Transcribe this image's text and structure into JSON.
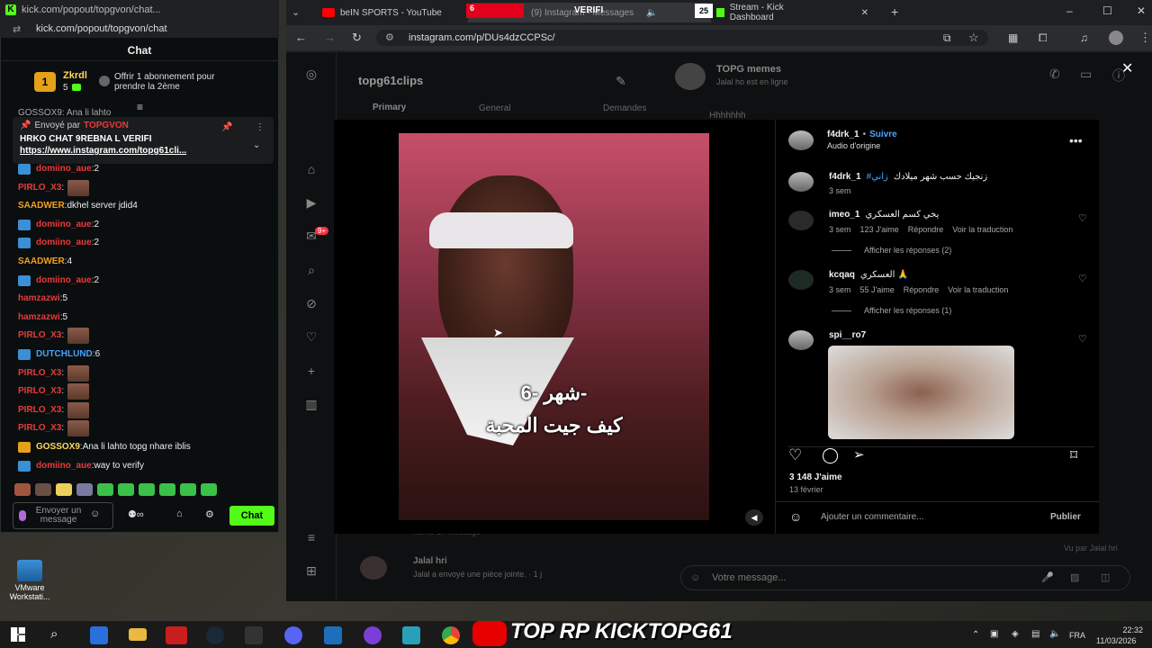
{
  "kick": {
    "tab_title": "kick.com/popout/topgvon/chat...",
    "url": "kick.com/popout/topgvon/chat",
    "header": "Chat",
    "sub_user": "Zkrdl",
    "sub_count": "5",
    "sub_badge": "1",
    "sub_offer": "Offrir 1 abonnement pour prendre la 2ème",
    "partial_line": "GOSSOX9: Ana li lahto",
    "pinned": {
      "sent_by_label": "Envoyé par",
      "sent_by_user": "TOPGVON",
      "title": "HRKO CHAT 9REBNA L VERIFI",
      "link": "https://www.instagram.com/topg61cli..."
    },
    "messages": [
      {
        "user": "domiino_aue",
        "sep": ": ",
        "text": "2",
        "color": "red",
        "icon": true
      },
      {
        "user": "PIRLO_X3",
        "sep": ": ",
        "text": "",
        "color": "red",
        "icon": false,
        "thumb": true
      },
      {
        "user": "SAADWER",
        "sep": ": ",
        "text": "dkhel server jdid4",
        "color": "orange",
        "icon": false
      },
      {
        "user": "domiino_aue",
        "sep": ": ",
        "text": "2",
        "color": "red",
        "icon": true
      },
      {
        "user": "domiino_aue",
        "sep": ": ",
        "text": "2",
        "color": "red",
        "icon": true
      },
      {
        "user": "SAADWER",
        "sep": ": ",
        "text": "4",
        "color": "orange",
        "icon": false
      },
      {
        "user": "domiino_aue",
        "sep": ": ",
        "text": "2",
        "color": "red",
        "icon": true
      },
      {
        "user": "hamzazwi",
        "sep": ": ",
        "text": "5",
        "color": "red",
        "icon": false
      },
      {
        "user": "hamzazwi",
        "sep": ": ",
        "text": "5",
        "color": "red",
        "icon": false
      },
      {
        "user": "PIRLO_X3",
        "sep": ": ",
        "text": "",
        "color": "red",
        "icon": false,
        "thumb": true
      },
      {
        "user": "DUTCHLUND",
        "sep": ": ",
        "text": "6",
        "color": "blue",
        "icon": true
      },
      {
        "user": "PIRLO_X3",
        "sep": ": ",
        "text": "",
        "color": "red",
        "icon": false,
        "thumb": true
      },
      {
        "user": "PIRLO_X3",
        "sep": ": ",
        "text": "",
        "color": "red",
        "icon": false,
        "thumb": true
      },
      {
        "user": "PIRLO_X3",
        "sep": ": ",
        "text": "",
        "color": "red",
        "icon": false,
        "thumb": true
      },
      {
        "user": "PIRLO_X3",
        "sep": ": ",
        "text": "",
        "color": "red",
        "icon": false,
        "thumb": true
      },
      {
        "user": "GOSSOX9",
        "sep": ": ",
        "text": "Ana li lahto topg nhare iblis",
        "color": "yellow",
        "icon": true
      },
      {
        "user": "domiino_aue",
        "sep": ": ",
        "text": "way to verify",
        "color": "red",
        "icon": true
      }
    ],
    "input_placeholder": "Envoyer un message",
    "chat_button": "Chat",
    "accent": "#53fc18"
  },
  "browser": {
    "tabs": [
      {
        "label": "beIN SPORTS - YouTube"
      },
      {
        "label": "(9) Instagram • Messages"
      },
      {
        "label": "Stream - Kick Dashboard"
      }
    ],
    "overlay_tab_left": "6",
    "overlay_tab_mid": "VERIFI",
    "overlay_tab_right": "25",
    "url": "instagram.com/p/DUs4dzCCPSc/"
  },
  "instagram": {
    "dm_account": "topg61clips",
    "dm_tabs": [
      "Primary",
      "General",
      "Demandes"
    ],
    "thread_name": "TOPG memes",
    "thread_status": "Jalal ho est en ligne",
    "thread_msg": "Hhhhhhh",
    "chat_item_name": "Jalal hri",
    "chat_item_preview": "Jalal a envoyé une pièce jointe. · 1 j",
    "chat_item_seen": "Vu par Jalal hri",
    "partial_chat": "l'aime un message",
    "message_placeholder": "Votre message...",
    "nav_badge": "9+",
    "post": {
      "author": "f4drk_1",
      "follow": "Suivre",
      "audio": "Audio d'origine",
      "caption_user": "f4drk_1",
      "caption_text": "زنجيك حسب شهر ميلادك",
      "caption_tag": "#زاني",
      "caption_time": "3 sem",
      "video_text_1": "شهر -6-",
      "video_text_2": "كيف جيت المحبة",
      "comments": [
        {
          "user": "imeo_1",
          "text": "يخي كسم العسكري",
          "time": "3 sem",
          "likes": "123 J'aime",
          "reply": "Répondre",
          "translate": "Voir la traduction",
          "replies": "Afficher les réponses (2)"
        },
        {
          "user": "kcqaq",
          "text": "العسكري 🙏",
          "time": "3 sem",
          "likes": "55 J'aime",
          "reply": "Répondre",
          "translate": "Voir la traduction",
          "replies": "Afficher les réponses (1)"
        },
        {
          "user": "spi__ro7",
          "text": "",
          "time": "",
          "likes": "",
          "reply": "",
          "translate": "",
          "replies": ""
        }
      ],
      "likes": "3 148 J'aime",
      "date": "13 février",
      "add_comment": "Ajouter un commentaire...",
      "publish": "Publier",
      "link_color": "#0095f6"
    }
  },
  "taskbar": {
    "overlay_text": "TOP RP KICKTOPG61",
    "lang": "FRA",
    "time": "22:32",
    "date": "11/03/2026",
    "vmware_label": "VMware Workstati..."
  }
}
